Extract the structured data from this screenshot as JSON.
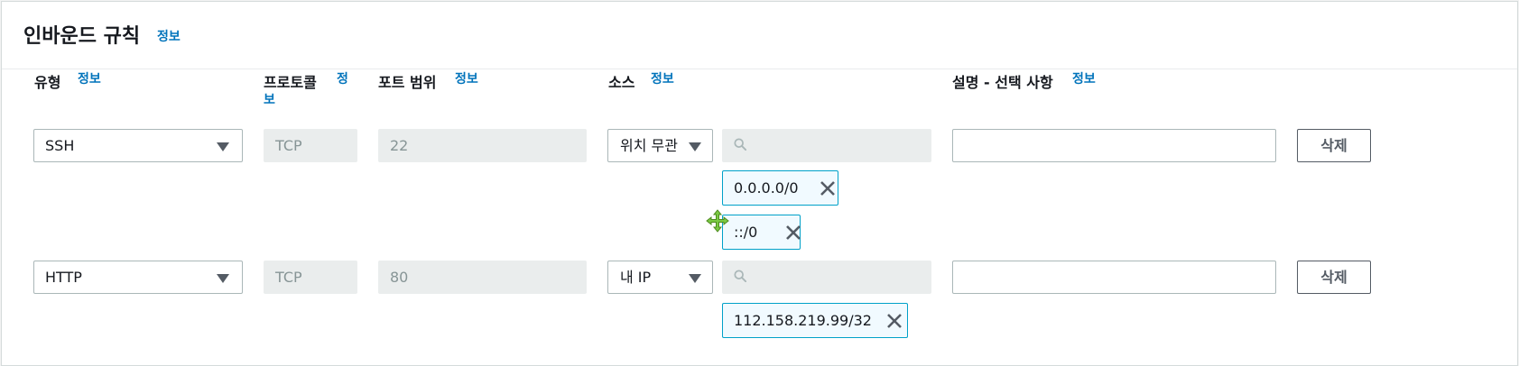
{
  "section": {
    "title": "인바운드 규칙",
    "info": "정보"
  },
  "columns": {
    "type": {
      "label": "유형",
      "info": "정보"
    },
    "protocol": {
      "label": "프로토콜",
      "info_line1": "정",
      "info_line2": "보"
    },
    "port": {
      "label": "포트 범위",
      "info": "정보"
    },
    "source": {
      "label": "소스",
      "info": "정보"
    },
    "description": {
      "label": "설명 - 선택 사항",
      "info": "정보"
    }
  },
  "rules": [
    {
      "type": "SSH",
      "protocol": "TCP",
      "port": "22",
      "source_mode": "위치 무관",
      "search_placeholder": "",
      "tokens": [
        "0.0.0.0/0",
        "::/0"
      ],
      "description": "",
      "delete_label": "삭제"
    },
    {
      "type": "HTTP",
      "protocol": "TCP",
      "port": "80",
      "source_mode": "내 IP",
      "search_placeholder": "",
      "tokens": [
        "112.158.219.99/32"
      ],
      "description": "",
      "delete_label": "삭제"
    }
  ],
  "colors": {
    "link": "#0073bb",
    "token_border": "#00a1c9",
    "token_bg": "#f1faff",
    "move_cursor": "#7ac943"
  },
  "icons": {
    "search": "search-icon",
    "remove": "close-icon",
    "dropdown": "caret-down-icon",
    "cursor": "move-cursor-icon"
  }
}
